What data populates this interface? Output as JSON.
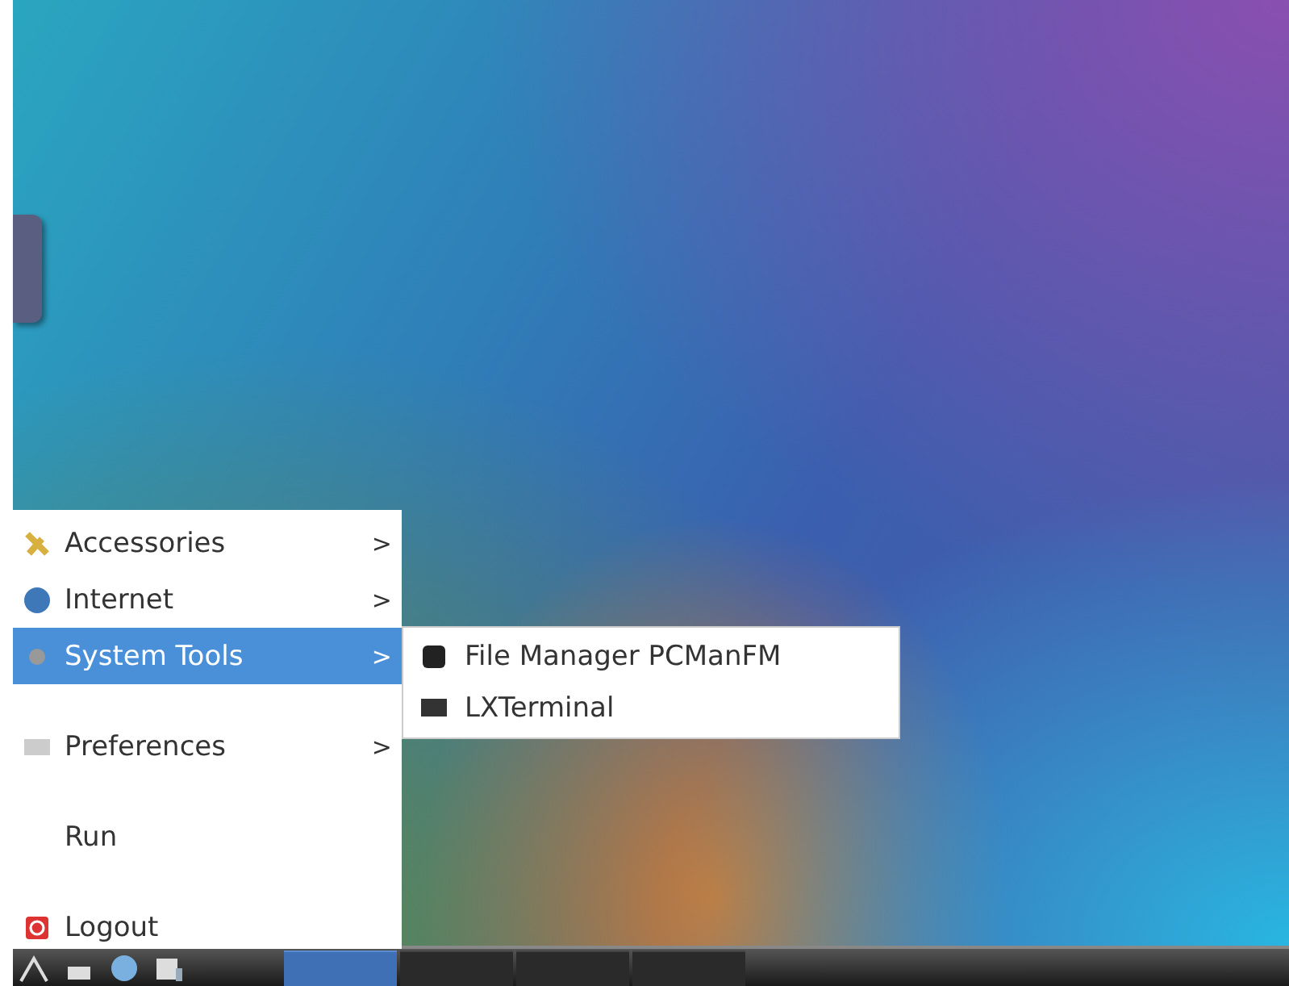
{
  "menu": {
    "items": [
      {
        "kind": "entry",
        "label": "Accessories",
        "arrow": ">",
        "selected": false
      },
      {
        "kind": "entry",
        "label": "Internet",
        "arrow": ">",
        "selected": false
      },
      {
        "kind": "entry",
        "label": "System Tools",
        "arrow": ">",
        "selected": true
      },
      {
        "kind": "separator"
      },
      {
        "kind": "entry",
        "label": "Preferences",
        "arrow": ">",
        "selected": false
      },
      {
        "kind": "separator"
      },
      {
        "kind": "entry",
        "label": "Run",
        "selected": false
      },
      {
        "kind": "separator"
      },
      {
        "kind": "entry",
        "label": "Logout",
        "selected": false
      }
    ]
  },
  "submenu": {
    "items": [
      {
        "label": "File Manager PCManFM"
      },
      {
        "label": "LXTerminal"
      }
    ]
  },
  "taskbar": {
    "tasks": [
      {
        "selected": true
      },
      {
        "selected": false
      },
      {
        "selected": false
      },
      {
        "selected": false
      }
    ]
  }
}
